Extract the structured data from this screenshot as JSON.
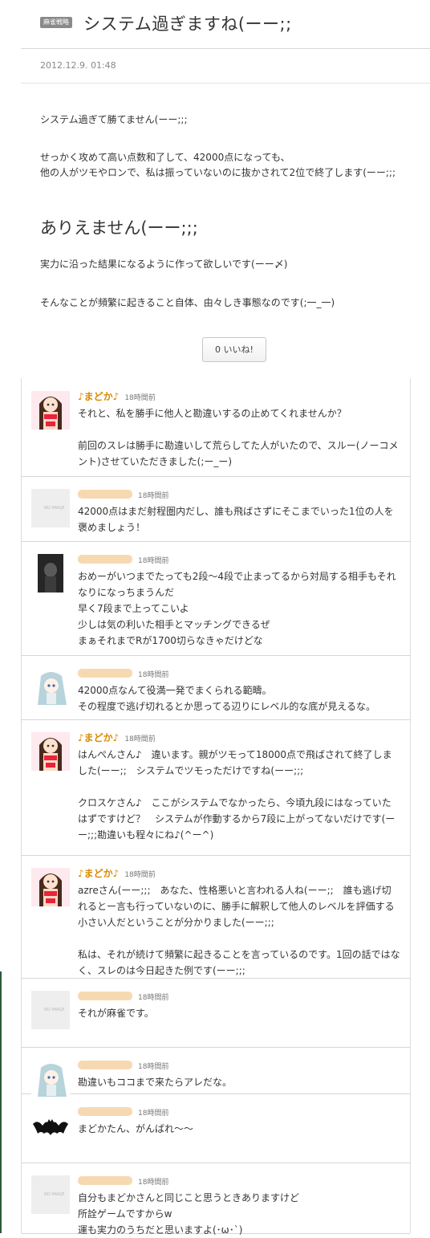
{
  "post": {
    "category": "麻雀戦略",
    "title": "システム過ぎますね(ーー;;",
    "date": "2012.12.9. 01:48",
    "paragraphs": [
      "システム過ぎて勝てません(ーー;;;",
      "せっかく攻めて高い点数和了して、42000点になっても、",
      "他の人がツモやロンで、私は振っていないのに抜かされて2位で終了します(ーー;;;",
      "ありえません(ーー;;;",
      "実力に沿った結果になるように作って欲しいです(ーー〆)",
      "そんなことが頻繁に起きること自体、由々しき事態なのです(;一_一)"
    ],
    "like_label": "0 いいね!"
  },
  "comments": [
    {
      "author": "♪まどか♪",
      "time": "18時間前",
      "avatar": "anime-girl-avatar",
      "lines": [
        "それと、私を勝手に他人と勘違いするの止めてくれませんか？",
        "",
        "前回のスレは勝手に勘違いして荒らしてた人がいたので、スルー(ノーコメント)させていただきました(;ー_ー)"
      ]
    },
    {
      "author": "",
      "time": "18時間前",
      "avatar": "no-image-avatar",
      "noimg": "NO IMAGE",
      "lines": [
        "42000点はまだ射程圏内だし、誰も飛ばさずにそこまでいった1位の人を褒めましょう！"
      ]
    },
    {
      "author": "",
      "time": "18時間前",
      "avatar": "dark-photo-avatar",
      "lines": [
        "おめーがいつまでたっても2段〜4段で止まってるから対局する相手もそれなりになっちまうんだ",
        "早く7段まで上ってこいよ",
        "少しは気の利いた相手とマッチングできるぜ",
        "まぁそれまでRが1700切らなきゃだけどな"
      ]
    },
    {
      "author": "",
      "time": "18時間前",
      "avatar": "silver-hair-avatar",
      "lines": [
        "42000点なんて役満一発でまくられる範疇。",
        "その程度で逃げ切れるとか思ってる辺りにレベル的な底が見えるな。"
      ]
    },
    {
      "author": "♪まどか♪",
      "time": "18時間前",
      "avatar": "anime-girl-avatar",
      "lines": [
        "はんぺんさん♪　違います。親がツモって18000点で飛ばされて終了しました(ーー;;　システムでツモっただけですね(ーー;;;",
        "",
        "クロスケさん♪　ここがシステムでなかったら、今頃九段にはなっていたはずですけど？　システムが作動するから7段に上がってないだけです(ーー;;;勘違いも程々にね♪(^ー^)"
      ]
    },
    {
      "author": "♪まどか♪",
      "time": "18時間前",
      "avatar": "anime-girl-avatar",
      "lines": [
        "azreさん(ーー;;;　あなた、性格悪いと言われる人ね(ーー;;　誰も逃げ切れるとー言も行っていないのに、勝手に解釈して他人のレベルを評価する小さい人だということが分かりました(ーー;;;",
        "",
        "私は、それが続けて頻繁に起きることを言っているのです。1回の話ではなく、スレのは今日起きた例です(ーー;;;"
      ]
    },
    {
      "author": "",
      "time": "18時間前",
      "avatar": "no-image-avatar",
      "noimg": "NO IMAGE",
      "lines": [
        "それが麻雀です。"
      ]
    },
    {
      "author": "",
      "time": "18時間前",
      "avatar": "silver-hair-avatar",
      "lines": [
        "勘違いもココまで来たらアレだな。"
      ]
    },
    {
      "author": "",
      "time": "18時間前",
      "avatar": "bat-avatar",
      "lines": [
        "まどかたん、がんばれ〜〜"
      ]
    },
    {
      "author": "",
      "time": "18時間前",
      "avatar": "no-image-avatar",
      "noimg": "NO IMAGE",
      "lines": [
        "自分もまどかさんと同じこと思うときありますけど",
        "所詮ゲームですからw",
        "運も実力のうちだと思いますよ(･ω･`)"
      ]
    }
  ]
}
